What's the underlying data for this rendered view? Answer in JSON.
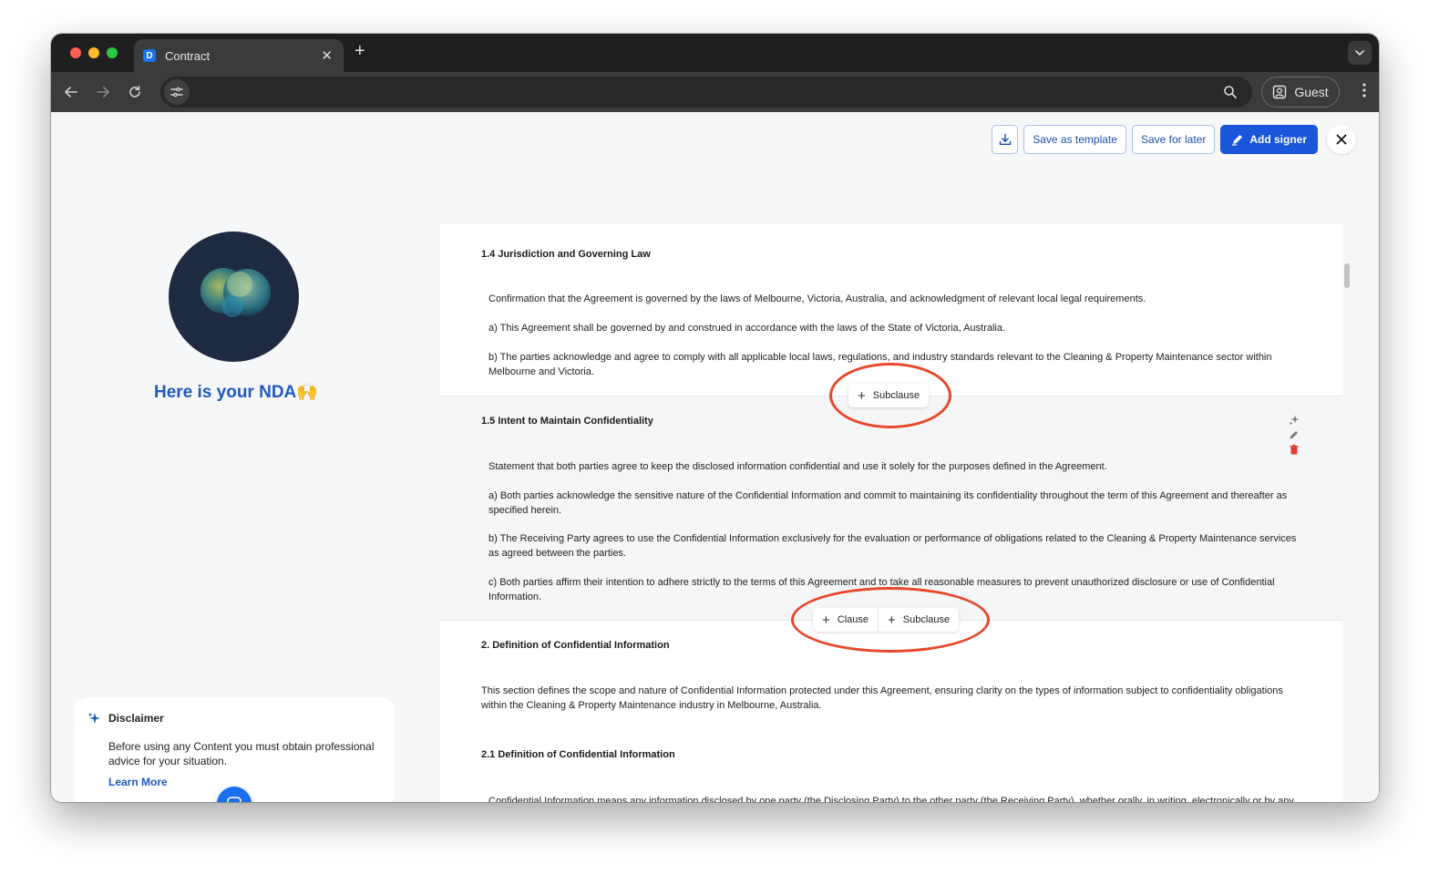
{
  "browser": {
    "tab_title": "Contract",
    "favicon_letter": "D",
    "url": "",
    "guest_label": "Guest"
  },
  "actions": {
    "save_template": "Save as template",
    "save_later": "Save for later",
    "add_signer": "Add signer"
  },
  "left_panel": {
    "headline": "Here is your NDA🙌",
    "disclaimer": {
      "title": "Disclaimer",
      "body": "Before using any Content you must obtain professional advice for your situation.",
      "link": "Learn More"
    }
  },
  "document": {
    "sections": [
      {
        "heading": "1.4 Jurisdiction and Governing Law",
        "paragraphs": [
          "Confirmation that the Agreement is governed by the laws of Melbourne, Victoria, Australia, and acknowledgment of relevant local legal requirements.",
          "a) This Agreement shall be governed by and construed in accordance with the laws of the State of Victoria, Australia.",
          "b) The parties acknowledge and agree to comply with all applicable local laws, regulations, and industry standards relevant to the Cleaning & Property Maintenance sector within Melbourne and Victoria."
        ]
      },
      {
        "heading": "1.5 Intent to Maintain Confidentiality",
        "paragraphs": [
          "Statement that both parties agree to keep the disclosed information confidential and use it solely for the purposes defined in the Agreement.",
          "a) Both parties acknowledge the sensitive nature of the Confidential Information and commit to maintaining its confidentiality throughout the term of this Agreement and thereafter as specified herein.",
          "b) The Receiving Party agrees to use the Confidential Information exclusively for the evaluation or performance of obligations related to the Cleaning & Property Maintenance services as agreed between the parties.",
          "c) Both parties affirm their intention to adhere strictly to the terms of this Agreement and to take all reasonable measures to prevent unauthorized disclosure or use of Confidential Information."
        ]
      },
      {
        "heading": "2. Definition of Confidential Information",
        "paragraphs": [
          "This section defines the scope and nature of Confidential Information protected under this Agreement, ensuring clarity on the types of information subject to confidentiality obligations within the Cleaning & Property Maintenance industry in Melbourne, Australia."
        ]
      },
      {
        "heading": "2.1 Definition of Confidential Information",
        "paragraphs": [
          "Confidential Information means any information disclosed by one party (the Disclosing Party) to the other party (the Receiving Party), whether orally, in writing, electronically or by any other means, that is designated as confidential or that a reasonable person would understand to be confidential given the nature of the"
        ]
      }
    ],
    "add_subclause": "Subclause",
    "add_clause": "Clause"
  },
  "colors": {
    "accent": "#1a56db",
    "annotation_ring": "#e8472a",
    "delete": "#e53935"
  },
  "icons": [
    "download-icon",
    "sign-pen-icon",
    "close-icon",
    "sparkle-icon",
    "pencil-icon",
    "trash-icon",
    "chat-icon",
    "search-icon",
    "profile-icon"
  ]
}
